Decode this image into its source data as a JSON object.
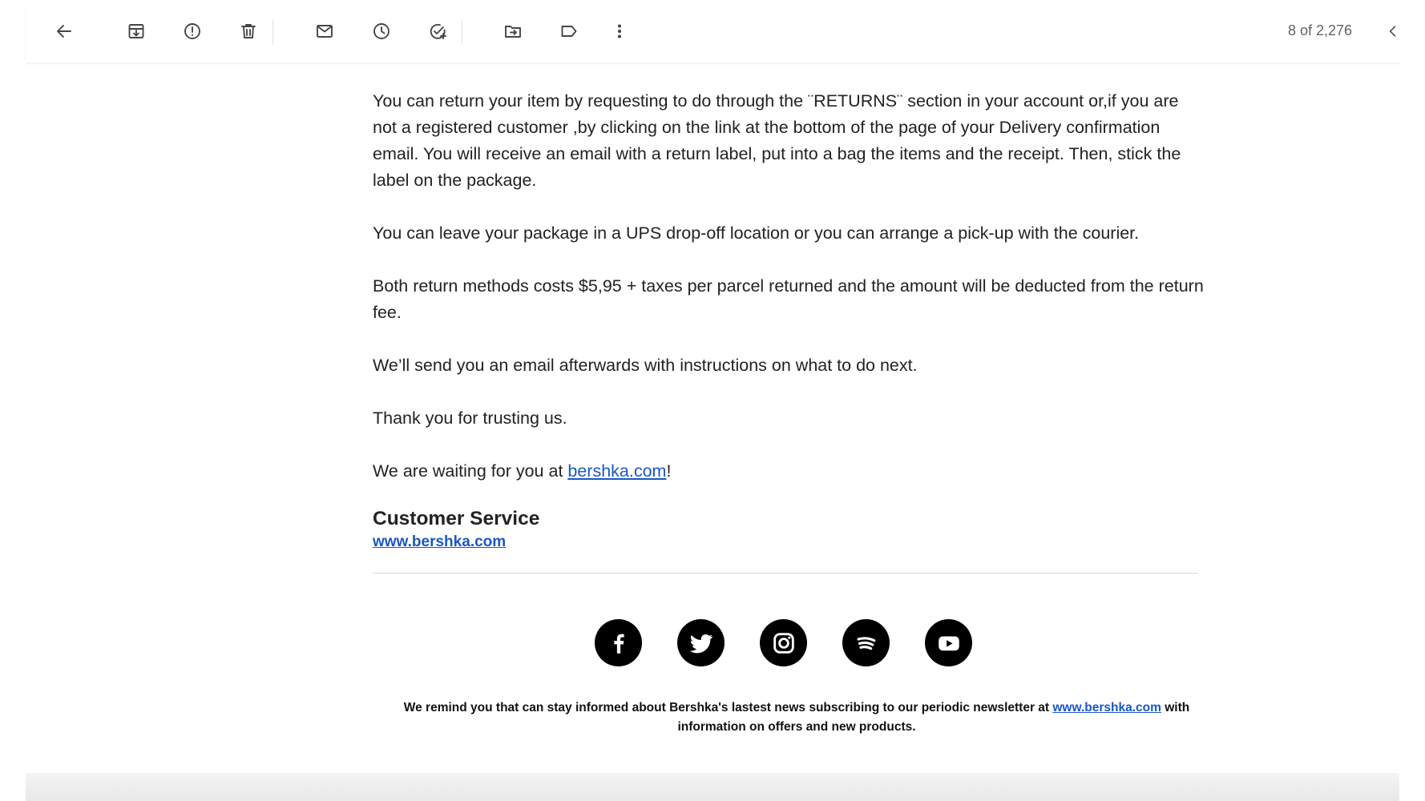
{
  "toolbar": {
    "icons": [
      "back-arrow-icon",
      "archive-icon",
      "report-spam-icon",
      "trash-icon",
      "mark-unread-icon",
      "snooze-icon",
      "add-task-icon",
      "move-to-icon",
      "label-icon",
      "more-vert-icon"
    ],
    "counter": "8 of 2,276"
  },
  "email": {
    "paragraphs": [
      "You can return your item by requesting to do through the ¨RETURNS¨ section in your account or,if you are not a registered customer ,by clicking on the link at the bottom of the page of your Delivery confirmation email. You will receive an email with a return label, put into a bag the items and the receipt. Then, stick the label on the package.",
      "You can leave your package in a UPS drop-off location or you can arrange a pick-up with the courier.",
      "Both return methods costs $5,95 + taxes per parcel returned and the amount will be deducted from the return fee.",
      "We’ll send you an email afterwards with instructions on what to do next.",
      "Thank you for trusting us."
    ],
    "waiting_prefix": "We are waiting for you at ",
    "waiting_link": "bershka.com",
    "waiting_suffix": "!",
    "signature_title": "Customer Service",
    "signature_link": "www.bershka.com",
    "social": [
      "facebook-icon",
      "twitter-icon",
      "instagram-icon",
      "spotify-icon",
      "youtube-icon"
    ],
    "footer_prefix": "We remind you that can stay informed about Bershka's lastest news subscribing to our periodic newsletter at ",
    "footer_link": "www.bershka.com",
    "footer_suffix": " with information on offers and new products."
  },
  "colors": {
    "link": "#1a57c6",
    "text": "#222222",
    "icon": "#444746"
  }
}
